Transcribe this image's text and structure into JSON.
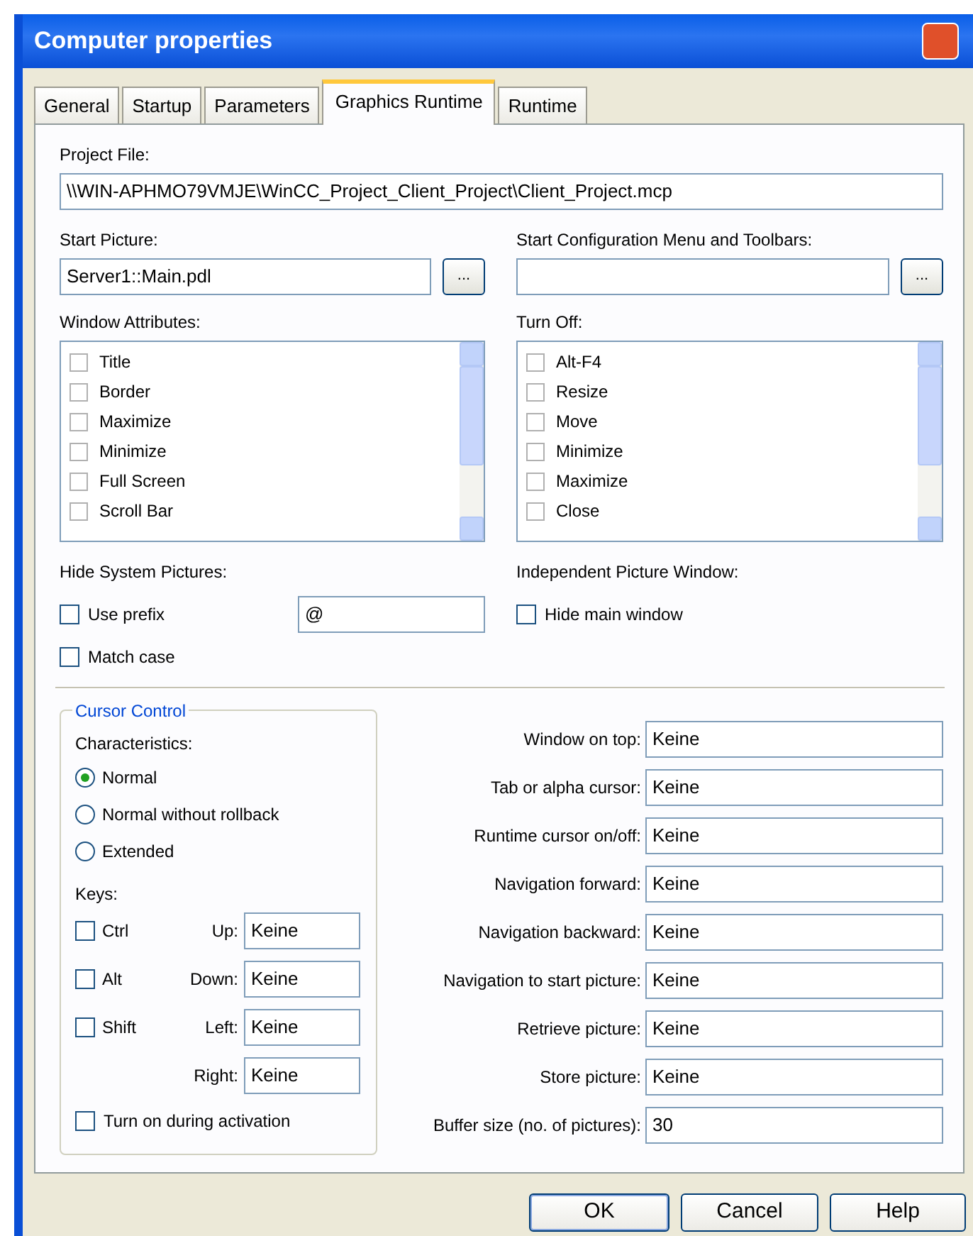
{
  "window": {
    "title": "Computer properties"
  },
  "tabs": [
    {
      "label": "General",
      "selected": false
    },
    {
      "label": "Startup",
      "selected": false
    },
    {
      "label": "Parameters",
      "selected": false
    },
    {
      "label": "Graphics Runtime",
      "selected": true
    },
    {
      "label": "Runtime",
      "selected": false
    }
  ],
  "project_file": {
    "label": "Project File:",
    "value": "\\\\WIN-APHMO79VMJE\\WinCC_Project_Client_Project\\Client_Project.mcp"
  },
  "start_picture": {
    "label": "Start Picture:",
    "value": "Server1::Main.pdl",
    "browse": "..."
  },
  "start_configuration": {
    "label": "Start Configuration Menu and Toolbars:",
    "browse": "..."
  },
  "window_attributes": {
    "label": "Window Attributes:",
    "items": [
      {
        "label": "Title",
        "checked": false
      },
      {
        "label": "Border",
        "checked": false
      },
      {
        "label": "Maximize",
        "checked": false
      },
      {
        "label": "Minimize",
        "checked": false
      },
      {
        "label": "Full Screen",
        "checked": false
      },
      {
        "label": "Scroll Bar",
        "checked": false
      }
    ]
  },
  "turn_off": {
    "label": "Turn Off:",
    "items": [
      {
        "label": "Alt-F4",
        "checked": false
      },
      {
        "label": "Resize",
        "checked": false
      },
      {
        "label": "Move",
        "checked": false
      },
      {
        "label": "Minimize",
        "checked": false
      },
      {
        "label": "Maximize",
        "checked": false
      },
      {
        "label": "Close",
        "checked": false
      }
    ]
  },
  "hide_system_pictures": {
    "label": "Hide System Pictures:",
    "use_prefix": {
      "label": "Use prefix",
      "checked": false
    },
    "prefix": "@",
    "match_case": {
      "label": "Match case",
      "checked": false
    }
  },
  "independent_picture_window": {
    "label": "Independent Picture Window:",
    "hide_main_window": {
      "label": "Hide main window",
      "checked": false
    }
  },
  "cursor_control": {
    "title": "Cursor Control",
    "characteristics_label": "Characteristics:",
    "modes": [
      {
        "label": "Normal",
        "selected": true
      },
      {
        "label": "Normal without rollback",
        "selected": false
      },
      {
        "label": "Extended",
        "selected": false
      }
    ],
    "keys_label": "Keys:",
    "modifiers": [
      {
        "label": "Ctrl",
        "checked": false
      },
      {
        "label": "Alt",
        "checked": false
      },
      {
        "label": "Shift",
        "checked": false
      }
    ],
    "directions": [
      {
        "label": "Up:",
        "value": "Keine"
      },
      {
        "label": "Down:",
        "value": "Keine"
      },
      {
        "label": "Left:",
        "value": "Keine"
      },
      {
        "label": "Right:",
        "value": "Keine"
      }
    ],
    "turn_on_during_activation": {
      "label": "Turn on during activation",
      "checked": false
    }
  },
  "hotkeys": [
    {
      "label": "Window on top:",
      "value": "Keine"
    },
    {
      "label": "Tab or alpha cursor:",
      "value": "Keine"
    },
    {
      "label": "Runtime cursor on/off:",
      "value": "Keine"
    },
    {
      "label": "Navigation forward:",
      "value": "Keine"
    },
    {
      "label": "Navigation backward:",
      "value": "Keine"
    },
    {
      "label": "Navigation to start picture:",
      "value": "Keine"
    },
    {
      "label": "Retrieve picture:",
      "value": "Keine"
    },
    {
      "label": "Store picture:",
      "value": "Keine"
    },
    {
      "label": "Buffer size (no. of pictures):",
      "value": "30"
    }
  ],
  "buttons": [
    {
      "label": "OK",
      "default": true
    },
    {
      "label": "Cancel",
      "default": false
    },
    {
      "label": "Help",
      "default": false
    }
  ]
}
